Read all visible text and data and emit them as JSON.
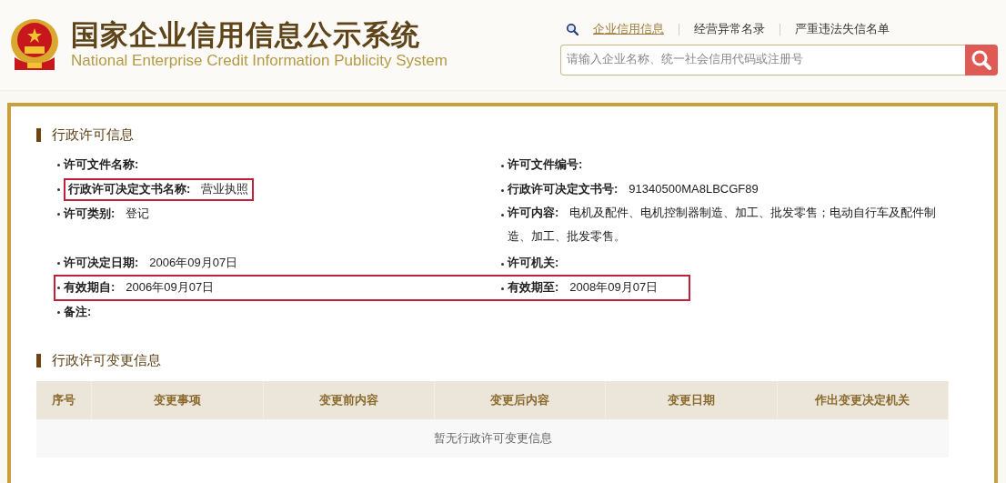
{
  "header": {
    "title_cn": "国家企业信用信息公示系统",
    "title_en": "National Enterprise Credit Information Publicity System"
  },
  "nav_links": [
    {
      "label": "企业信用信息",
      "selected": true
    },
    {
      "label": "经营异常名录",
      "selected": false
    },
    {
      "label": "严重违法失信名单",
      "selected": false
    }
  ],
  "search": {
    "placeholder": "请输入企业名称、统一社会信用代码或注册号"
  },
  "license_section": {
    "title": "行政许可信息",
    "rows": [
      {
        "fields": [
          {
            "label": "许可文件名称:",
            "highlighted": false
          },
          {
            "label": "许可文件编号:",
            "highlighted": false
          }
        ]
      },
      {
        "fields": [
          {
            "label": "行政许可决定文书名称:",
            "value": "营业执照",
            "highlighted": true
          },
          {
            "label": "行政许可决定文书号:",
            "value": "91340500MA8LBCGF89",
            "highlighted": false
          }
        ]
      },
      {
        "fields": [
          {
            "label": "许可类别:",
            "value": "登记",
            "highlighted": false
          },
          {
            "label": "许可内容:",
            "value": "电机及配件、电机控制器制造、加工、批发零售；电动自行车及配件制造、加工、批发零售。",
            "highlighted": false
          }
        ]
      },
      {
        "fields": [
          {
            "label": "许可决定日期:",
            "value": "2006年09月07日",
            "highlighted": false
          },
          {
            "label": "许可机关:",
            "highlighted": false
          }
        ]
      },
      {
        "fields": [
          {
            "label": "有效期自:",
            "value": "2006年09月07日",
            "highlighted": true
          },
          {
            "label": "有效期至:",
            "value": "2008年09月07日",
            "highlighted": true
          }
        ]
      },
      {
        "fields": [
          {
            "label": "备注:",
            "highlighted": false
          }
        ]
      }
    ]
  },
  "change_section": {
    "title": "行政许可变更信息",
    "table": {
      "columns": [
        "序号",
        "变更事项",
        "变更前内容",
        "变更后内容",
        "变更日期",
        "作出变更决定机关"
      ],
      "empty_message": "暂无行政许可变更信息"
    }
  }
}
